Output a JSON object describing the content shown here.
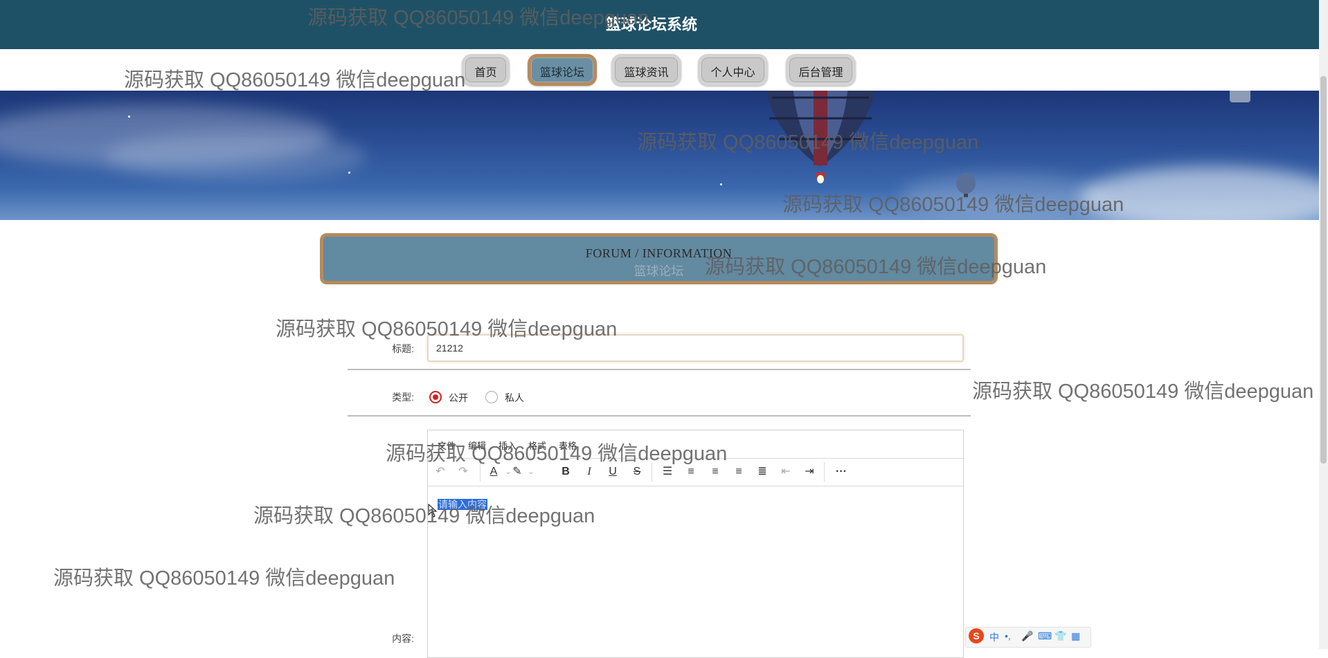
{
  "header": {
    "title": "篮球论坛系统"
  },
  "nav": {
    "items": [
      {
        "label": "首页",
        "active": false
      },
      {
        "label": "篮球论坛",
        "active": true
      },
      {
        "label": "篮球资讯",
        "active": false
      },
      {
        "label": "个人中心",
        "active": false
      },
      {
        "label": "后台管理",
        "active": false
      }
    ]
  },
  "section": {
    "title_en": "FORUM / INFORMATION",
    "title_cn": "篮球论坛"
  },
  "form": {
    "title_label": "标题:",
    "title_value": "21212",
    "type_label": "类型:",
    "type_options": [
      {
        "label": "公开",
        "selected": true
      },
      {
        "label": "私人",
        "selected": false
      }
    ],
    "content_label": "内容:"
  },
  "editor": {
    "menu": [
      "文件",
      "编辑",
      "插入",
      "格式",
      "表格"
    ],
    "toolbar_icons": [
      "undo-icon",
      "redo-icon",
      "text-color-icon",
      "highlight-color-icon",
      "bold-icon",
      "italic-icon",
      "underline-icon",
      "strikethrough-icon",
      "line-height-icon",
      "align-left-icon",
      "align-center-icon",
      "align-right-icon",
      "align-justify-icon",
      "outdent-icon",
      "indent-icon",
      "more-icon"
    ],
    "placeholder": "请输入内容"
  },
  "ime": {
    "label": "中"
  },
  "watermark": {
    "text": "源码获取 QQ86050149 微信deepguan"
  },
  "colors": {
    "header_bg": "#1f5166",
    "active_nav": "#6a8fa3",
    "accent_border": "#b58b5c",
    "radio_selected": "#cc2222"
  }
}
